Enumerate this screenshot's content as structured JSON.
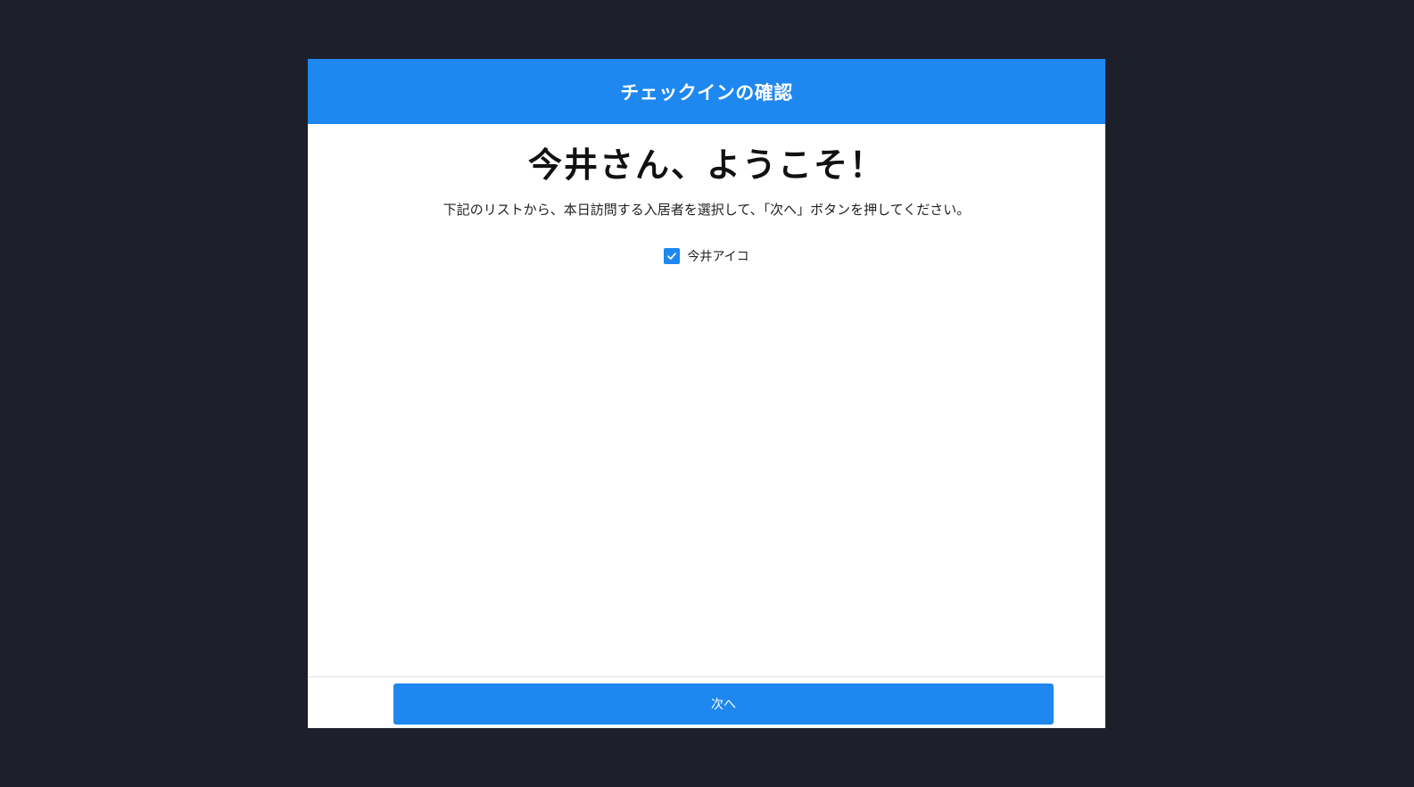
{
  "dialog": {
    "title": "チェックインの確認"
  },
  "body": {
    "welcome": "今井さん、ようこそ！",
    "instructions": "下記のリストから、本日訪問する入居者を選択して、「次へ」ボタンを押してください。",
    "residents": [
      {
        "name": "今井アイコ",
        "checked": true
      }
    ]
  },
  "footer": {
    "next_label": "次へ"
  },
  "colors": {
    "accent": "#1e87f0",
    "backdrop": "#1d1f2b"
  },
  "icons": {
    "checkbox": "check-icon"
  }
}
